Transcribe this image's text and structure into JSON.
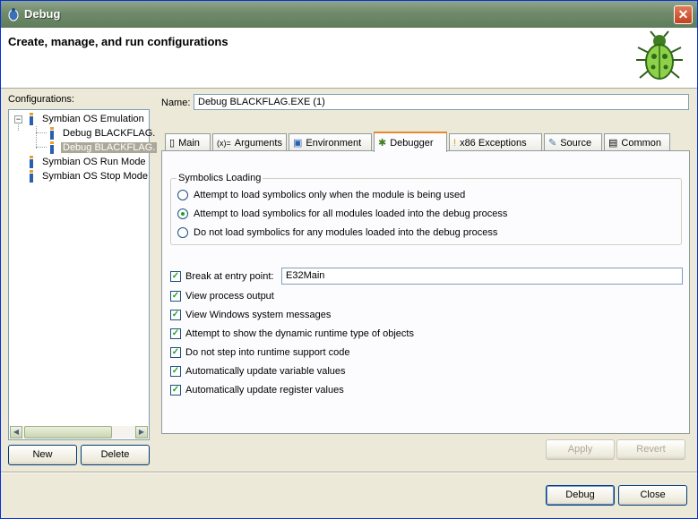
{
  "window": {
    "title": "Debug",
    "icons": {
      "app": "bug-icon",
      "close": "close-icon"
    }
  },
  "banner": {
    "heading": "Create, manage, and run configurations",
    "image": "green-bug-icon"
  },
  "configurations": {
    "label": "Configurations:",
    "tree": [
      {
        "label": "Symbian OS Emulation",
        "expander": "−"
      },
      {
        "label": "Debug BLACKFLAG."
      },
      {
        "label": "Debug BLACKFLAG."
      },
      {
        "label": "Symbian OS Run Mode"
      },
      {
        "label": "Symbian OS Stop Mode"
      }
    ],
    "new_label": "New",
    "delete_label": "Delete"
  },
  "name": {
    "label": "Name:",
    "value": "Debug BLACKFLAG.EXE (1)"
  },
  "tabs": [
    {
      "label": "Main",
      "icon": "page-icon"
    },
    {
      "label": "Arguments",
      "icon": "(x)="
    },
    {
      "label": "Environment",
      "icon": "environment-icon"
    },
    {
      "label": "Debugger",
      "icon": "bug-icon"
    },
    {
      "label": "x86 Exceptions",
      "icon": "exception-icon"
    },
    {
      "label": "Source",
      "icon": "source-icon"
    },
    {
      "label": "Common",
      "icon": "common-icon"
    }
  ],
  "debugger": {
    "symbolics_title": "Symbolics Loading",
    "radios": [
      {
        "label": "Attempt to load symbolics only when the module is being used",
        "checked": false
      },
      {
        "label": "Attempt to load symbolics for all modules loaded into the debug process",
        "checked": true
      },
      {
        "label": "Do not load symbolics for any modules loaded into the debug process",
        "checked": false
      }
    ],
    "break_label": "Break at entry point:",
    "break_value": "E32Main",
    "check_mark": "✓",
    "checkboxes": [
      "View process output",
      "View Windows system messages",
      "Attempt to show the dynamic runtime type of objects",
      "Do not step into runtime support code",
      "Automatically update variable values",
      "Automatically update register values"
    ]
  },
  "buttons": {
    "apply": "Apply",
    "revert": "Revert",
    "debug": "Debug",
    "close": "Close"
  },
  "scroll": {
    "left_arrow": "◀",
    "right_arrow": "▶"
  },
  "colors": {
    "titlebar": "#6f8a6a",
    "active_tab_accent": "#e68b2c",
    "selection": "#aca899"
  }
}
